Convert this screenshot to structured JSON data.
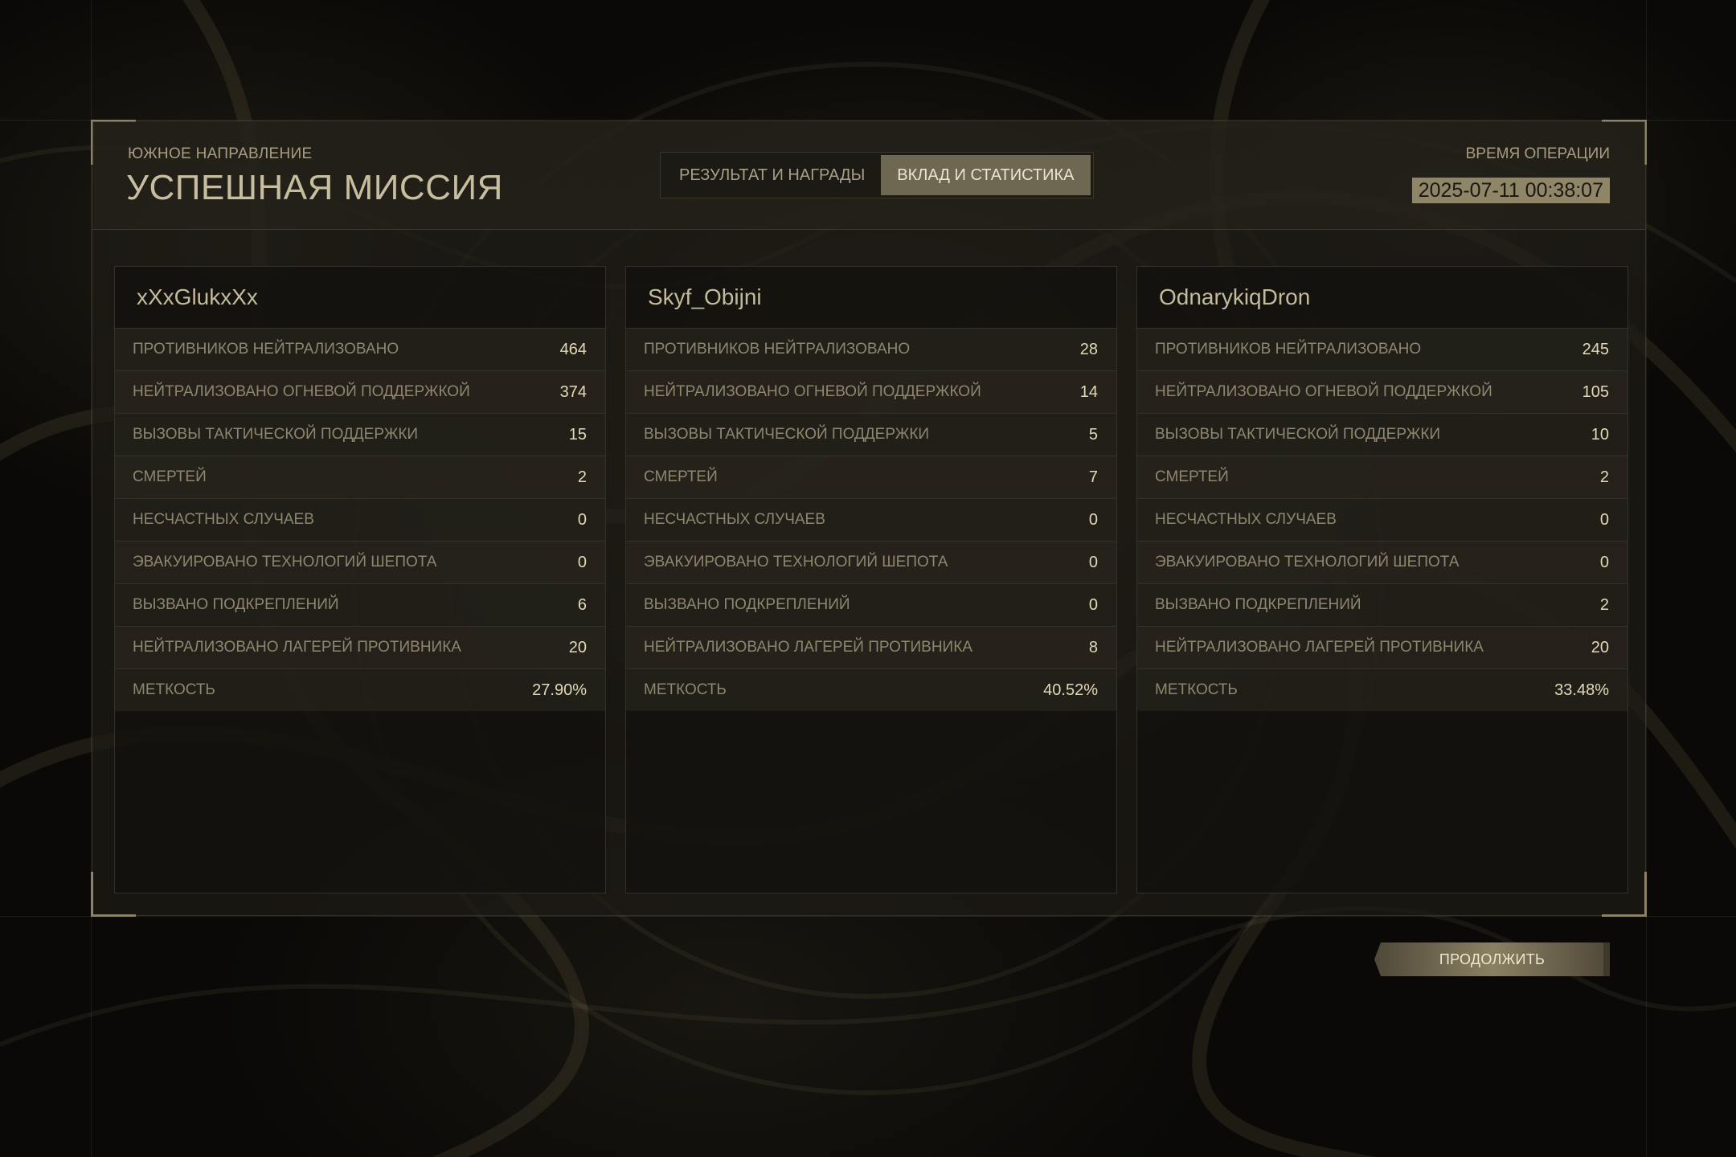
{
  "header": {
    "subtitle": "ЮЖНОЕ НАПРАВЛЕНИЕ",
    "title": "УСПЕШНАЯ МИССИЯ",
    "time_label": "ВРЕМЯ ОПЕРАЦИИ",
    "time_value": "2025-07-11 00:38:07"
  },
  "tabs": [
    {
      "label": "РЕЗУЛЬТАТ И НАГРАДЫ",
      "active": false
    },
    {
      "label": "ВКЛАД И СТАТИСТИКА",
      "active": true
    }
  ],
  "stat_labels": [
    "ПРОТИВНИКОВ НЕЙТРАЛИЗОВАНО",
    "НЕЙТРАЛИЗОВАНО ОГНЕВОЙ ПОДДЕРЖКОЙ",
    "ВЫЗОВЫ ТАКТИЧЕСКОЙ ПОДДЕРЖКИ",
    "СМЕРТЕЙ",
    "НЕСЧАСТНЫХ СЛУЧАЕВ",
    "ЭВАКУИРОВАНО ТЕХНОЛОГИЙ ШЕПОТА",
    "ВЫЗВАНО ПОДКРЕПЛЕНИЙ",
    "НЕЙТРАЛИЗОВАНО ЛАГЕРЕЙ ПРОТИВНИКА",
    "МЕТКОСТЬ"
  ],
  "players": [
    {
      "name": "xXxGlukxXx",
      "values": [
        "464",
        "374",
        "15",
        "2",
        "0",
        "0",
        "6",
        "20",
        "27.90%"
      ]
    },
    {
      "name": "Skyf_Obijni",
      "values": [
        "28",
        "14",
        "5",
        "7",
        "0",
        "0",
        "0",
        "8",
        "40.52%"
      ]
    },
    {
      "name": "OdnarykiqDron",
      "values": [
        "245",
        "105",
        "10",
        "2",
        "0",
        "0",
        "2",
        "20",
        "33.48%"
      ]
    }
  ],
  "continue_label": "ПРОДОЛЖИТЬ"
}
